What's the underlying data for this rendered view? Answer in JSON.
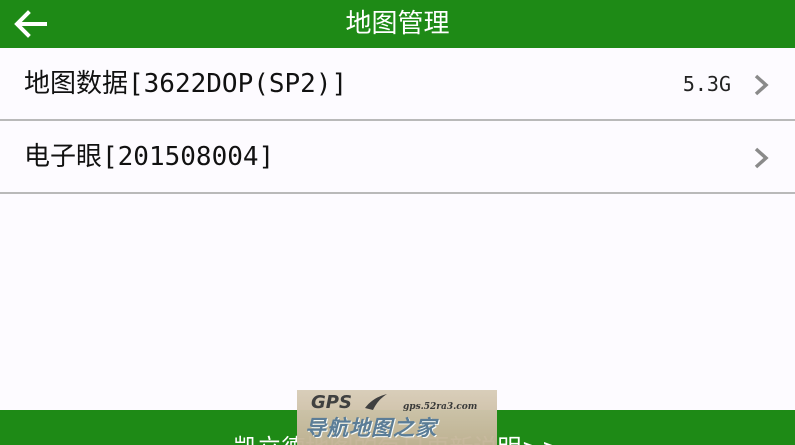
{
  "header": {
    "title": "地图管理",
    "back_icon": "arrow-left-icon"
  },
  "map_items": [
    {
      "label": "地图数据[3622DOP(SP2)]",
      "value": "5.3G",
      "icon": "chevron-right-icon"
    },
    {
      "label": "电子眼[201508004]",
      "value": "",
      "icon": "chevron-right-icon"
    }
  ],
  "footer": {
    "text": "凯立德地图的每日更新说明>>"
  },
  "watermark": {
    "logo": "GPS",
    "url": "gps.52ra3.com",
    "name": "导航地图之家"
  },
  "colors": {
    "accent": "#1e8a16",
    "background": "#fdfbff",
    "divider": "#b9b9b9",
    "chevron": "#8a8a8a"
  }
}
